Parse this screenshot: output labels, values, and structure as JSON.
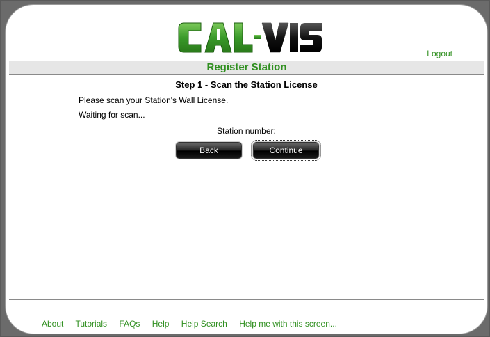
{
  "logo": {
    "text_left": "C",
    "text_mid": "A",
    "text_right": "L-VIS",
    "brand_green": "#3a9a2a",
    "brand_black": "#111111"
  },
  "header": {
    "logout_label": "Logout"
  },
  "page": {
    "title": "Register Station",
    "step_title": "Step 1 - Scan the Station License",
    "instruction_1": "Please scan your Station's Wall License.",
    "instruction_2": "Waiting for scan...",
    "station_number_label": "Station number:"
  },
  "buttons": {
    "back_label": "Back",
    "continue_label": "Continue"
  },
  "footer": {
    "links": [
      "About",
      "Tutorials",
      "FAQs",
      "Help",
      "Help Search",
      "Help me with this screen..."
    ]
  },
  "colors": {
    "accent_green": "#2f8f1f"
  }
}
